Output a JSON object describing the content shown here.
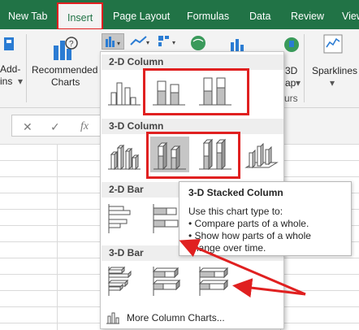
{
  "tabs": [
    {
      "label": "New Tab"
    },
    {
      "label": "Insert"
    },
    {
      "label": "Page Layout"
    },
    {
      "label": "Formulas"
    },
    {
      "label": "Data"
    },
    {
      "label": "Review"
    },
    {
      "label": "View"
    }
  ],
  "ribbon": {
    "addins_line1": "Add-",
    "addins_line2": "ins",
    "recommended_line1": "Recommended",
    "recommended_line2": "Charts",
    "map_label": "3D",
    "map_line2": "ap",
    "tours_label": "urs",
    "sparklines_label": "Sparklines"
  },
  "formula_bar": {
    "cancel_glyph": "✕",
    "enter_glyph": "✓",
    "fx_glyph": "fx"
  },
  "menu": {
    "sections": [
      {
        "title": "2-D Column"
      },
      {
        "title": "3-D Column"
      },
      {
        "title": "2-D Bar"
      },
      {
        "title": "3-D Bar"
      }
    ],
    "more_label": "More Column Charts..."
  },
  "tooltip": {
    "title": "3-D Stacked Column",
    "line1": "Use this chart type to:",
    "line2": "• Compare parts of a whole.",
    "line3": "• Show how parts of a whole",
    "line4": "change over time."
  },
  "colors": {
    "ribbon_green": "#217346",
    "highlight_red": "#e02020",
    "hover_gray": "#c6c6c6",
    "series_gray": "#c0c0c0"
  }
}
